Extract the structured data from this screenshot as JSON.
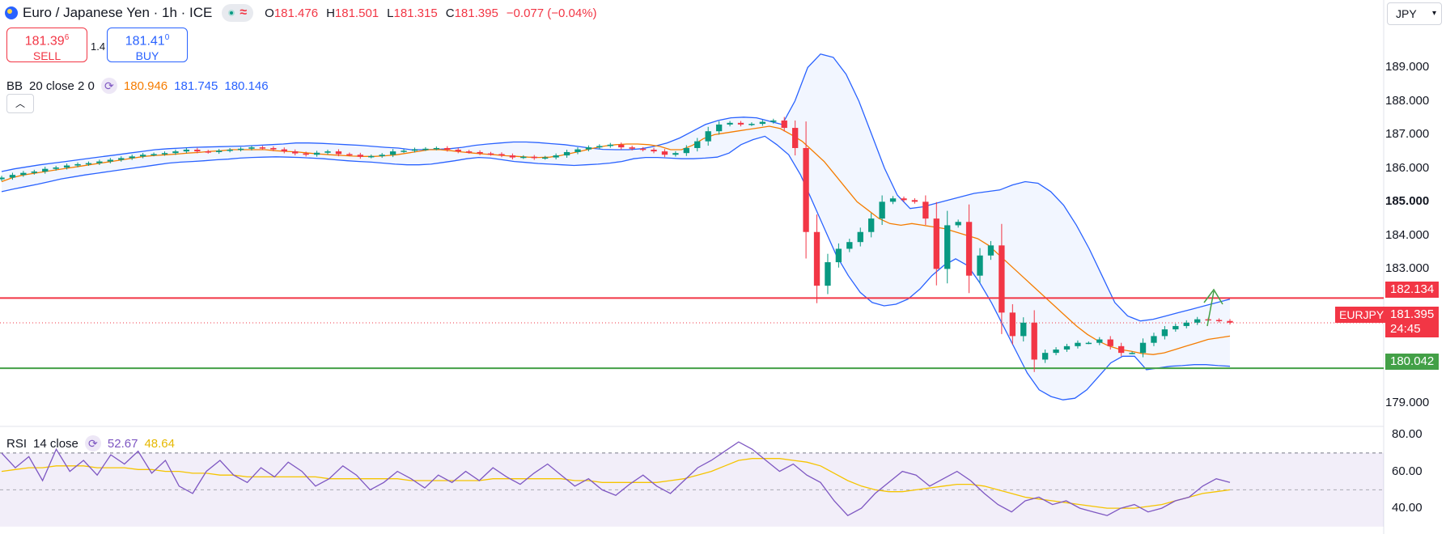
{
  "header": {
    "symbol_title": "Euro / Japanese Yen · 1h · ICE",
    "ohlc": [
      {
        "label": "O",
        "value": "181.476"
      },
      {
        "label": "H",
        "value": "181.501"
      },
      {
        "label": "L",
        "value": "181.315"
      },
      {
        "label": "C",
        "value": "181.395"
      }
    ],
    "change": "−0.077 (−0.04%)",
    "status_icon": "market-open-dot",
    "wave_icon": "≈"
  },
  "trade": {
    "sell_price": "181.39",
    "sell_price_sup": "6",
    "sell_label": "SELL",
    "spread": "1.4",
    "buy_price": "181.41",
    "buy_price_sup": "0",
    "buy_label": "BUY"
  },
  "bb_legend": {
    "name": "BB",
    "params": "20 close 2 0",
    "basis": "180.946",
    "upper": "181.745",
    "lower": "180.146"
  },
  "rsi_legend": {
    "name": "RSI",
    "params": "14 close",
    "rsi": "52.67",
    "ma": "48.64"
  },
  "currency": {
    "selected": "JPY"
  },
  "price_axis": [
    "189.000",
    "188.000",
    "187.000",
    "186.000",
    "185.000",
    "184.000",
    "183.000",
    "179.000"
  ],
  "price_tags": {
    "resistance": "182.134",
    "support": "180.042",
    "symbol": "EURJPY",
    "last_price": "181.395",
    "countdown": "24:45"
  },
  "rsi_axis": [
    "80.00",
    "60.00",
    "40.00"
  ],
  "colors": {
    "up": "#089981",
    "down": "#f23645",
    "bb_band": "#2962ff",
    "bb_basis": "#f57c00",
    "rsi_line": "#7e57c2",
    "rsi_ma": "#f5c400",
    "resistance": "#f23645",
    "support": "#43a047"
  },
  "chart_data": {
    "type": "candlestick",
    "price_range": [
      178.6,
      189.9
    ],
    "price_ticks": [
      179,
      183,
      184,
      185,
      186,
      187,
      188,
      189
    ],
    "horizontal_lines": [
      {
        "value": 182.134,
        "color": "#f23645"
      },
      {
        "value": 180.042,
        "color": "#43a047"
      }
    ],
    "last_price": 181.395,
    "bb_basis": [
      185.6,
      185.72,
      185.8,
      185.85,
      185.9,
      185.95,
      186.0,
      186.05,
      186.1,
      186.15,
      186.2,
      186.25,
      186.3,
      186.35,
      186.38,
      186.4,
      186.42,
      186.45,
      186.47,
      186.5,
      186.52,
      186.55,
      186.55,
      186.55,
      186.55,
      186.52,
      186.5,
      186.48,
      186.45,
      186.42,
      186.4,
      186.38,
      186.36,
      186.35,
      186.35,
      186.37,
      186.4,
      186.45,
      186.5,
      186.55,
      186.55,
      186.52,
      186.48,
      186.45,
      186.42,
      186.4,
      186.37,
      186.35,
      186.33,
      186.32,
      186.33,
      186.38,
      186.45,
      186.52,
      186.6,
      186.66,
      186.7,
      186.72,
      186.72,
      186.7,
      186.65,
      186.55,
      186.55,
      186.68,
      186.88,
      187.0,
      187.05,
      187.1,
      187.15,
      187.2,
      187.25,
      187.18,
      187.0,
      186.8,
      186.5,
      186.2,
      185.8,
      185.4,
      185.0,
      184.75,
      184.5,
      184.35,
      184.3,
      184.35,
      184.3,
      184.25,
      184.2,
      184.1,
      184.0,
      183.9,
      183.7,
      183.4,
      183.1,
      182.8,
      182.5,
      182.2,
      181.9,
      181.6,
      181.3,
      181.05,
      180.85,
      180.7,
      180.6,
      180.55,
      180.48,
      180.45,
      180.5,
      180.6,
      180.7,
      180.8,
      180.9,
      180.95,
      181.0
    ],
    "bb_upper": [
      185.9,
      185.98,
      186.04,
      186.1,
      186.15,
      186.2,
      186.25,
      186.3,
      186.35,
      186.4,
      186.45,
      186.5,
      186.55,
      186.58,
      186.6,
      186.62,
      186.63,
      186.64,
      186.65,
      186.66,
      186.68,
      186.7,
      186.72,
      186.75,
      186.75,
      186.74,
      186.72,
      186.7,
      186.68,
      186.65,
      186.62,
      186.6,
      186.55,
      186.55,
      186.56,
      186.58,
      186.62,
      186.68,
      186.72,
      186.75,
      186.78,
      186.78,
      186.76,
      186.73,
      186.7,
      186.65,
      186.6,
      186.56,
      186.55,
      186.55,
      186.58,
      186.65,
      186.75,
      186.9,
      187.1,
      187.3,
      187.42,
      187.5,
      187.52,
      187.5,
      187.4,
      187.3,
      188.0,
      189.0,
      189.4,
      189.3,
      188.8,
      188.0,
      187.0,
      186.0,
      185.2,
      184.8,
      184.85,
      184.95,
      185.05,
      185.15,
      185.25,
      185.3,
      185.35,
      185.5,
      185.6,
      185.55,
      185.3,
      184.9,
      184.3,
      183.6,
      182.8,
      182.0,
      181.6,
      181.45,
      181.5,
      181.6,
      181.7,
      181.8,
      181.9,
      182.0,
      182.1
    ],
    "bb_lower": [
      185.3,
      185.38,
      185.45,
      185.52,
      185.6,
      185.68,
      185.74,
      185.8,
      185.85,
      185.9,
      185.95,
      186.0,
      186.05,
      186.1,
      186.15,
      186.18,
      186.2,
      186.22,
      186.25,
      186.27,
      186.3,
      186.32,
      186.33,
      186.34,
      186.33,
      186.32,
      186.3,
      186.28,
      186.25,
      186.22,
      186.2,
      186.18,
      186.15,
      186.12,
      186.1,
      186.1,
      186.12,
      186.17,
      186.22,
      186.28,
      186.32,
      186.3,
      186.25,
      186.2,
      186.17,
      186.14,
      186.12,
      186.1,
      186.08,
      186.1,
      186.12,
      186.15,
      186.2,
      186.28,
      186.32,
      186.32,
      186.3,
      186.28,
      186.28,
      186.3,
      186.33,
      186.45,
      186.7,
      186.85,
      186.95,
      186.7,
      186.4,
      185.8,
      185.0,
      184.2,
      183.4,
      182.8,
      182.3,
      182.0,
      181.9,
      181.95,
      182.1,
      182.4,
      182.8,
      183.1,
      183.3,
      183.1,
      182.6,
      182.0,
      181.3,
      180.6,
      179.9,
      179.4,
      179.2,
      179.1,
      179.15,
      179.4,
      179.8,
      180.2,
      180.4,
      180.4,
      180.0,
      180.05,
      180.1,
      180.12,
      180.15,
      180.15,
      180.12,
      180.1
    ],
    "closes": [
      185.72,
      185.8,
      185.86,
      185.9,
      185.98,
      186.02,
      186.08,
      186.12,
      186.15,
      186.2,
      186.25,
      186.3,
      186.35,
      186.4,
      186.42,
      186.45,
      186.5,
      186.55,
      186.5,
      186.48,
      186.52,
      186.55,
      186.58,
      186.62,
      186.6,
      186.56,
      186.5,
      186.44,
      186.4,
      186.46,
      186.5,
      186.42,
      186.4,
      186.34,
      186.36,
      186.4,
      186.5,
      186.52,
      186.56,
      186.58,
      186.6,
      186.55,
      186.5,
      186.48,
      186.44,
      186.42,
      186.38,
      186.32,
      186.34,
      186.3,
      186.32,
      186.38,
      186.48,
      186.56,
      186.62,
      186.66,
      186.7,
      186.62,
      186.58,
      186.55,
      186.5,
      186.4,
      186.45,
      186.6,
      186.8,
      187.1,
      187.3,
      187.35,
      187.3,
      187.32,
      187.38,
      187.42,
      187.2,
      186.6,
      184.1,
      182.5,
      183.2,
      183.6,
      183.8,
      184.1,
      184.5,
      185.0,
      185.1,
      185.05,
      185.0,
      184.5,
      183.0,
      184.3,
      184.4,
      182.8,
      183.4,
      183.7,
      181.7,
      181.0,
      181.4,
      180.3,
      180.5,
      180.6,
      180.7,
      180.8,
      180.8,
      180.9,
      180.7,
      180.5,
      180.5,
      180.8,
      181.0,
      181.2,
      181.3,
      181.4,
      181.5,
      181.48,
      181.45,
      181.4
    ],
    "rsi": [
      70,
      62,
      68,
      55,
      72,
      60,
      66,
      58,
      69,
      64,
      71,
      59,
      66,
      52,
      48,
      60,
      66,
      58,
      54,
      62,
      57,
      65,
      60,
      52,
      56,
      63,
      58,
      50,
      54,
      60,
      56,
      51,
      58,
      54,
      60,
      55,
      62,
      57,
      53,
      59,
      64,
      58,
      52,
      56,
      50,
      47,
      53,
      58,
      52,
      48,
      55,
      62,
      66,
      71,
      76,
      72,
      66,
      60,
      64,
      58,
      54,
      44,
      36,
      40,
      48,
      54,
      60,
      58,
      52,
      56,
      60,
      55,
      48,
      42,
      38,
      44,
      46,
      42,
      44,
      40,
      38,
      36,
      40,
      42,
      38,
      40,
      44,
      46,
      52,
      56,
      54
    ],
    "rsi_ma": [
      60,
      61,
      62,
      62,
      63,
      63,
      63,
      62,
      62,
      62,
      61,
      61,
      60,
      60,
      59,
      59,
      58,
      58,
      57,
      57,
      57,
      57,
      57,
      57,
      56,
      56,
      56,
      56,
      56,
      56,
      55,
      55,
      55,
      55,
      55,
      55,
      56,
      56,
      56,
      56,
      56,
      56,
      55,
      55,
      54,
      54,
      54,
      54,
      54,
      55,
      56,
      58,
      60,
      63,
      66,
      67,
      67,
      67,
      66,
      65,
      63,
      59,
      55,
      52,
      50,
      49,
      49,
      50,
      51,
      52,
      53,
      53,
      52,
      50,
      48,
      46,
      45,
      44,
      43,
      42,
      41,
      40,
      40,
      40,
      41,
      42,
      44,
      46,
      48,
      49,
      50
    ],
    "rsi_ticks": [
      80,
      60,
      40
    ],
    "rsi_band": [
      70,
      30
    ]
  }
}
